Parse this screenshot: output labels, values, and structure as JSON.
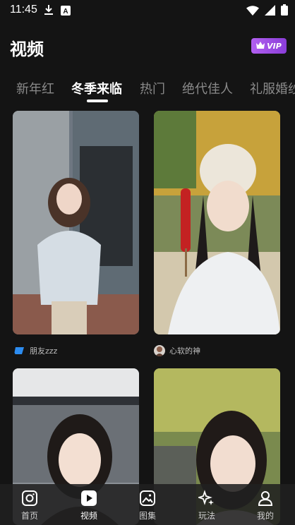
{
  "status_bar": {
    "time": "11:45",
    "icons": [
      "download-icon",
      "notification-a-icon",
      "wifi-icon",
      "signal-icon",
      "battery-icon"
    ]
  },
  "header": {
    "title": "视频",
    "vip_label": "VIP",
    "vip_color": "#9b4de6"
  },
  "tabs": [
    {
      "label": "新年红"
    },
    {
      "label": "冬季来临",
      "active": true
    },
    {
      "label": "热门"
    },
    {
      "label": "绝代佳人"
    },
    {
      "label": "礼服婚纱"
    }
  ],
  "feed": [
    {
      "author": "朋友zzz",
      "avatar_icon": "blue-square-avatar"
    },
    {
      "author": "心软的神",
      "avatar_icon": "portrait-avatar"
    },
    {
      "author": ""
    },
    {
      "author": ""
    }
  ],
  "bottom_nav": [
    {
      "label": "首页",
      "icon": "home-camera-icon"
    },
    {
      "label": "视频",
      "icon": "play-icon",
      "active": true
    },
    {
      "label": "图集",
      "icon": "gallery-icon"
    },
    {
      "label": "玩法",
      "icon": "sparkle-icon"
    },
    {
      "label": "我的",
      "icon": "profile-icon"
    }
  ]
}
